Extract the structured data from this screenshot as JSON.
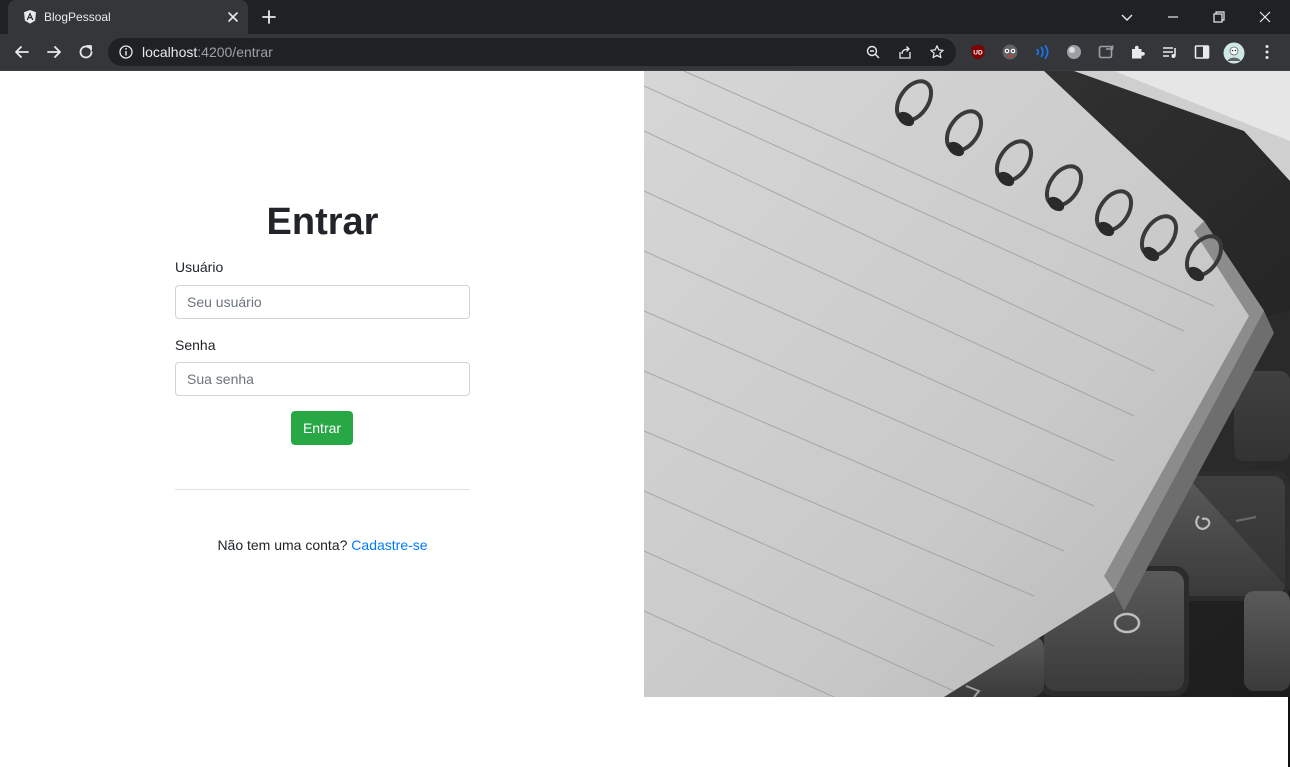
{
  "browser": {
    "tab_title": "BlogPessoal",
    "url_host": "localhost",
    "url_path": ":4200/entrar"
  },
  "login": {
    "title": "Entrar",
    "username_label": "Usuário",
    "username_placeholder": "Seu usuário",
    "password_label": "Senha",
    "password_placeholder": "Sua senha",
    "submit_label": "Entrar",
    "signup_prompt": "Não tem uma conta?",
    "signup_link": "Cadastre-se"
  },
  "colors": {
    "submit_button": "#28a745",
    "link": "#007bff",
    "chrome_dark": "#202124",
    "chrome_toolbar": "#35363a"
  },
  "hero_image": {
    "description_icon": "notebook-keyboard-photo"
  }
}
